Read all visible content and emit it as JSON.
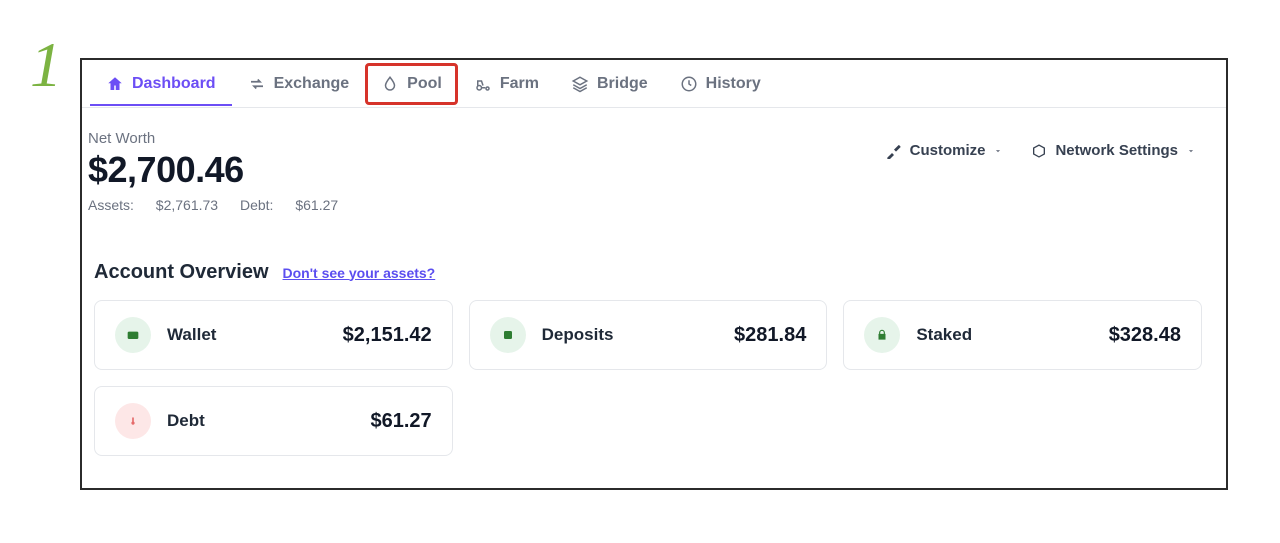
{
  "annotation": {
    "step_number": "1"
  },
  "nav": {
    "items": [
      {
        "label": "Dashboard",
        "icon": "home-icon"
      },
      {
        "label": "Exchange",
        "icon": "swap-icon"
      },
      {
        "label": "Pool",
        "icon": "drop-icon"
      },
      {
        "label": "Farm",
        "icon": "tractor-icon"
      },
      {
        "label": "Bridge",
        "icon": "layers-icon"
      },
      {
        "label": "History",
        "icon": "clock-icon"
      }
    ],
    "active_index": 0,
    "highlighted_index": 2
  },
  "net_worth": {
    "label": "Net Worth",
    "value": "$2,700.46",
    "assets_label": "Assets:",
    "assets_value": "$2,761.73",
    "debt_label": "Debt:",
    "debt_value": "$61.27"
  },
  "settings": {
    "customize_label": "Customize",
    "network_label": "Network Settings"
  },
  "overview": {
    "title": "Account Overview",
    "link_text": "Don't see your assets?",
    "cards": [
      {
        "label": "Wallet",
        "value": "$2,151.42",
        "icon": "wallet-icon",
        "tone": "green"
      },
      {
        "label": "Deposits",
        "value": "$281.84",
        "icon": "deposit-icon",
        "tone": "green"
      },
      {
        "label": "Staked",
        "value": "$328.48",
        "icon": "lock-icon",
        "tone": "green"
      },
      {
        "label": "Debt",
        "value": "$61.27",
        "icon": "thermo-icon",
        "tone": "red"
      }
    ]
  }
}
